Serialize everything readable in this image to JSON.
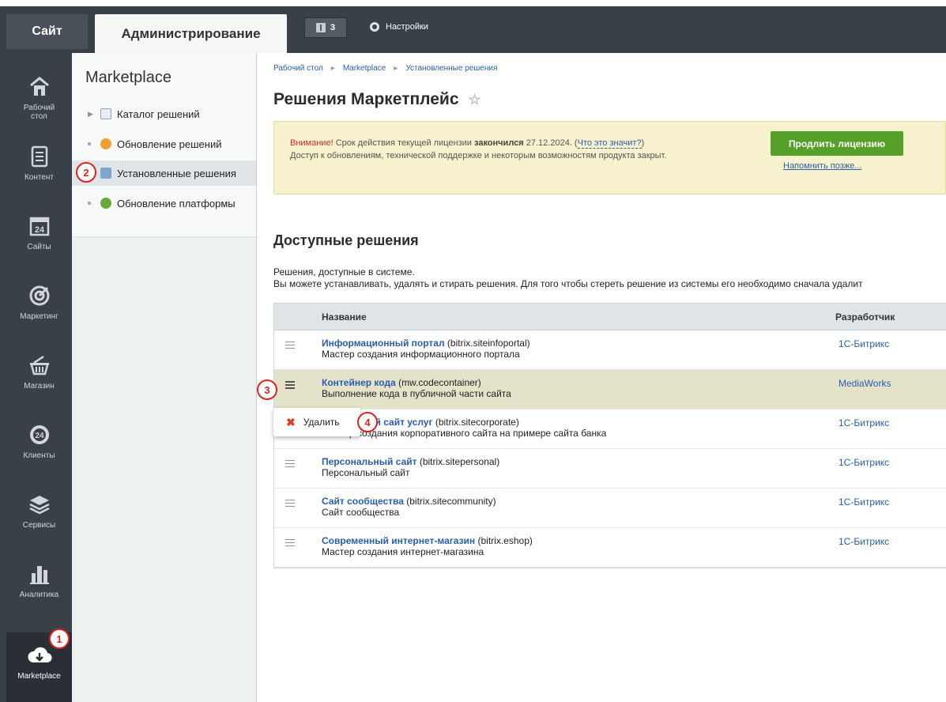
{
  "topbar": {
    "tab_site": "Сайт",
    "tab_admin": "Администрирование",
    "notifications_count": "3",
    "settings_label": "Настройки"
  },
  "leftbar": {
    "items": [
      {
        "label": "Рабочий стол",
        "icon": "home-icon"
      },
      {
        "label": "Контент",
        "icon": "document-icon"
      },
      {
        "label": "Сайты",
        "icon": "calendar-24-icon"
      },
      {
        "label": "Маркетинг",
        "icon": "target-icon"
      },
      {
        "label": "Магазин",
        "icon": "basket-icon"
      },
      {
        "label": "Клиенты",
        "icon": "clients-24-icon"
      },
      {
        "label": "Сервисы",
        "icon": "layers-icon"
      },
      {
        "label": "Аналитика",
        "icon": "bar-chart-icon"
      },
      {
        "label": "Marketplace",
        "icon": "cloud-download-icon"
      }
    ]
  },
  "submenu": {
    "title": "Marketplace",
    "items": [
      {
        "label": "Каталог решений"
      },
      {
        "label": "Обновление решений"
      },
      {
        "label": "Установленные решения"
      },
      {
        "label": "Обновление платформы"
      }
    ]
  },
  "breadcrumb": [
    "Рабочий стол",
    "Marketplace",
    "Установленные решения"
  ],
  "page_title": "Решения Маркетплейс",
  "alert": {
    "warn": "Внимание!",
    "t1": " Срок действия текущей лицензии ",
    "ended": "закончился",
    "t2": " 27.12.2024. (",
    "what_link": "Что это значит?",
    "t3": ")",
    "line2": "Доступ к обновлениям, технической поддержке и некоторым возможностям продукта закрыт.",
    "renew_button": "Продлить лицензию",
    "remind_link": "Напомнить позже..."
  },
  "section": {
    "title": "Доступные решения",
    "desc1": "Решения, доступные в системе.",
    "desc2": "Вы можете устанавливать, удалять и стирать решения. Для того чтобы стереть решение из системы его необходимо сначала удалит"
  },
  "table": {
    "col_name": "Название",
    "col_dev": "Разработчик",
    "rows": [
      {
        "name": "Информационный портал",
        "code": " (bitrix.siteinfoportal)",
        "desc": "Мастер создания информационного портала",
        "dev": "1С-Битрикс"
      },
      {
        "name": "Контейнер кода",
        "code": " (mw.codecontainer)",
        "desc": "Выполнение кода в публичной части сайта",
        "dev": "MediaWorks"
      },
      {
        "name": "ный сайт услуг",
        "code": " (bitrix.sitecorporate)",
        "desc": "Мастер создания корпоративного сайта на примере сайта банка",
        "dev": "1С-Битрикс"
      },
      {
        "name": "Персональный сайт",
        "code": " (bitrix.sitepersonal)",
        "desc": "Персональный сайт",
        "dev": "1С-Битрикс"
      },
      {
        "name": "Сайт сообщества",
        "code": " (bitrix.sitecommunity)",
        "desc": "Сайт сообщества",
        "dev": "1С-Битрикс"
      },
      {
        "name": "Современный интернет-магазин",
        "code": " (bitrix.eshop)",
        "desc": "Мастер создания интернет-магазина",
        "dev": "1С-Битрикс"
      }
    ]
  },
  "context_menu": {
    "delete_label": "Удалить"
  },
  "markers": [
    "1",
    "2",
    "3",
    "4"
  ],
  "colors": {
    "dark_bg": "#3a4048",
    "link": "#2a5dac",
    "green": "#55a029",
    "marker_red": "#d9241f",
    "alert_bg": "#f7f2cd"
  }
}
